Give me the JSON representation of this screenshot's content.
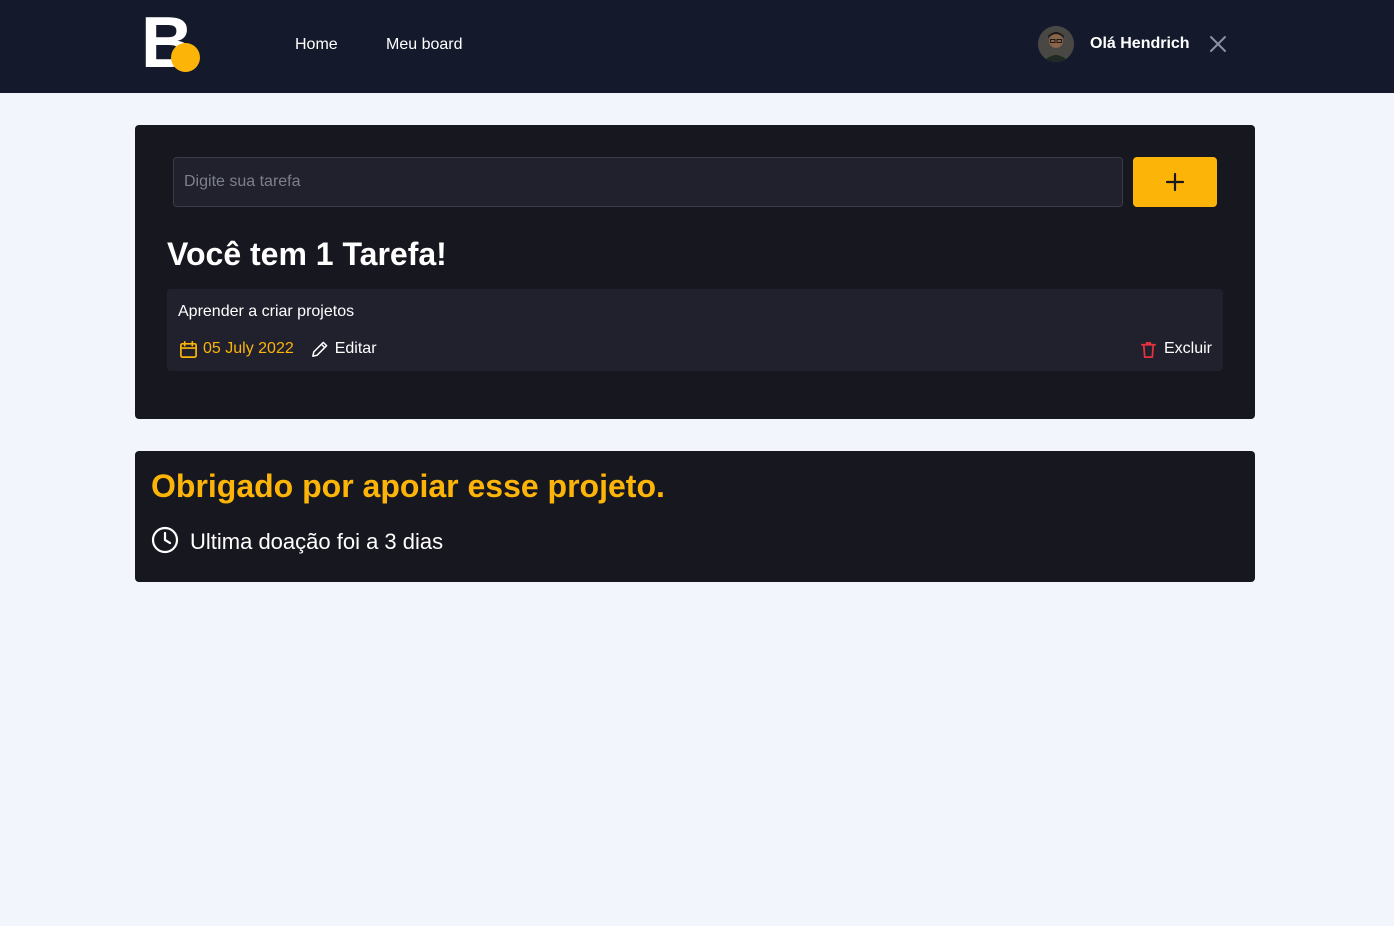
{
  "header": {
    "logo": {
      "letter": "B",
      "dot_color": "#fcb409",
      "name": "logo-b"
    },
    "nav": [
      {
        "label": "Home"
      },
      {
        "label": "Meu board"
      }
    ],
    "user": {
      "greeting": "Olá Hendrich",
      "avatar": "user-avatar",
      "close_icon": "close-icon"
    }
  },
  "tasks": {
    "input": {
      "placeholder": "Digite sua tarefa",
      "value": ""
    },
    "add_button_icon": "plus-icon",
    "title": "Você tem 1 Tarefa!",
    "items": [
      {
        "text": "Aprender a criar projetos",
        "date": "05 July 2022",
        "date_icon": "calendar-icon",
        "edit_label": "Editar",
        "edit_icon": "pencil-icon",
        "delete_label": "Excluir",
        "delete_icon": "trash-icon"
      }
    ]
  },
  "support": {
    "title": "Obrigado por apoiar esse projeto.",
    "last_donation": "Ultima doação foi a 3 dias",
    "clock_icon": "clock-icon"
  },
  "colors": {
    "accent": "#fcb409",
    "header_bg": "#141a2b",
    "page_bg": "#f2f5fc",
    "panel_bg": "#17171f",
    "card_bg": "#20212c",
    "danger": "#ea3140"
  }
}
